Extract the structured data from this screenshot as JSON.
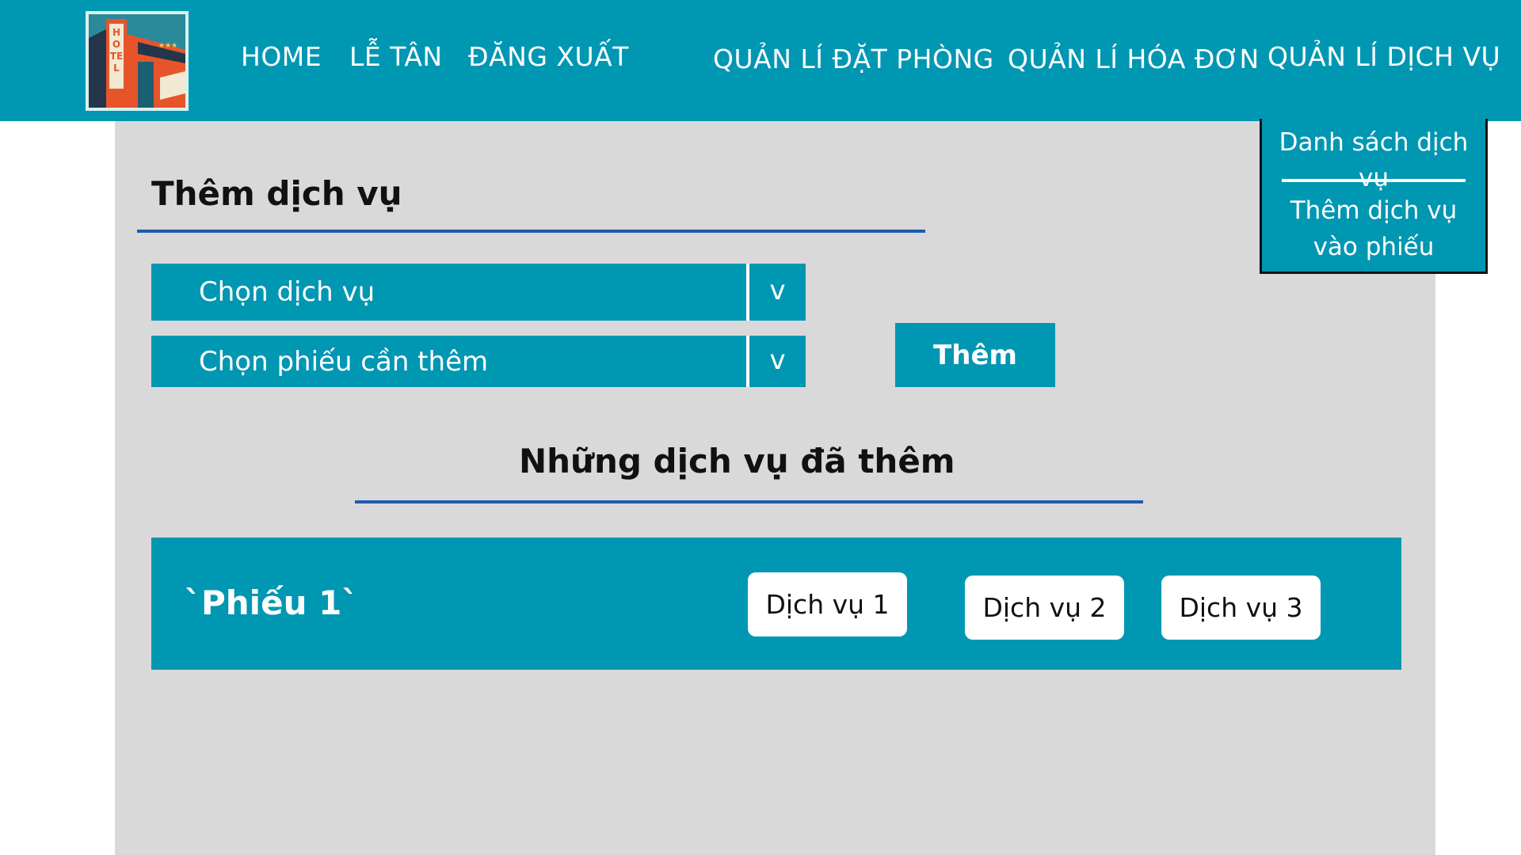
{
  "header": {
    "logo_text": "HOTEL",
    "nav": {
      "home": "HOME",
      "reception": "LỄ TÂN",
      "logout": "ĐĂNG XUẤT",
      "booking": "QUẢN LÍ ĐẶT PHÒNG",
      "invoice": "QUẢN LÍ HÓA ĐƠN",
      "service": "QUẢN LÍ DỊCH VỤ"
    }
  },
  "service_menu": {
    "items": [
      "Danh sách dịch vụ",
      "Thêm dịch vụ",
      "vào phiếu"
    ]
  },
  "add_form": {
    "title": "Thêm dịch vụ",
    "service_select": "Chọn dịch vụ",
    "ticket_select": "Chọn phiếu cần thêm",
    "arrow": "v",
    "add_button": "Thêm"
  },
  "added_section": {
    "title": "Những dịch vụ đã thêm",
    "tickets": [
      {
        "name": "`Phiếu 1`",
        "services": [
          "Dịch vụ 1",
          "Dịch vụ 2",
          "Dịch vụ 3"
        ]
      }
    ]
  },
  "colors": {
    "primary": "#0097b2",
    "panel": "#d9d9d9",
    "rule": "#1f5ab3",
    "logo_orange": "#e8542a"
  }
}
